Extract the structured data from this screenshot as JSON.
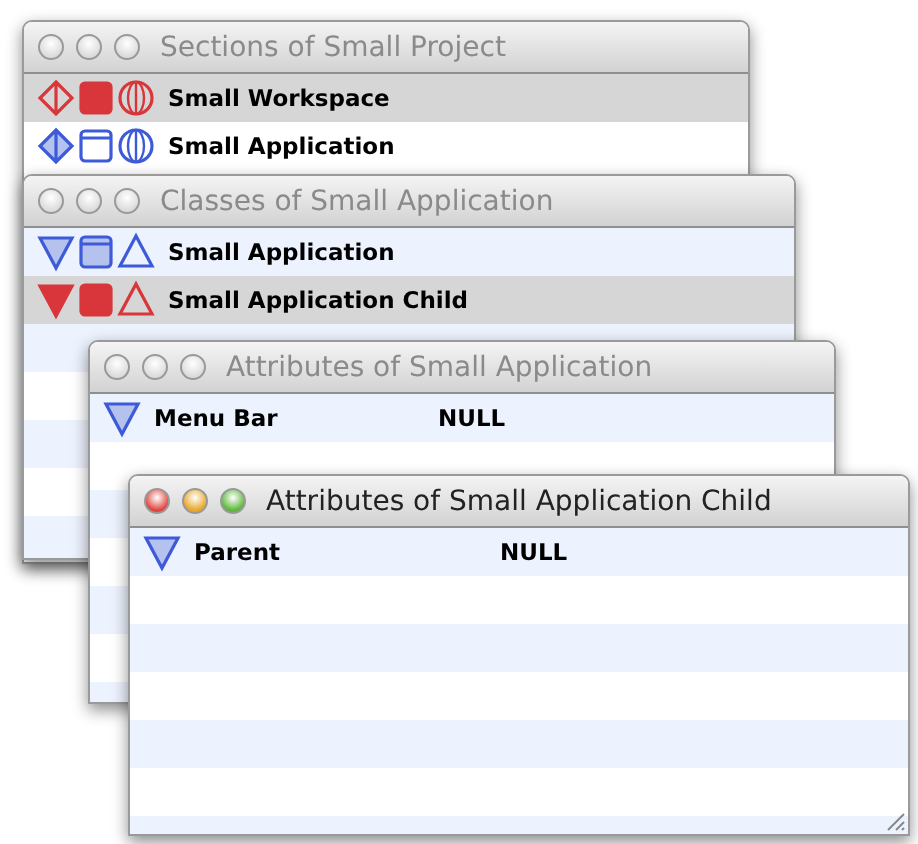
{
  "windows": [
    {
      "kind": "list",
      "title": "Sections of Small Project",
      "active": false,
      "rows": [
        {
          "name": "Small Workspace",
          "color": "#d8363a",
          "selected": true
        },
        {
          "name": "Small Application",
          "color": "#3d5ad8",
          "selected": false
        }
      ]
    },
    {
      "kind": "classes",
      "title": "Classes of Small Application",
      "active": false,
      "rows": [
        {
          "name": "Small Application",
          "color": "#3d5ad8",
          "selected": false
        },
        {
          "name": "Small Application Child",
          "color": "#d8363a",
          "selected": true
        }
      ]
    },
    {
      "kind": "table",
      "title": "Attributes of Small Application",
      "active": false,
      "rows": [
        {
          "name": "Menu Bar",
          "value": "NULL"
        }
      ]
    },
    {
      "kind": "table",
      "title": "Attributes of Small Application Child",
      "active": true,
      "rows": [
        {
          "name": "Parent",
          "value": "NULL"
        }
      ]
    }
  ]
}
